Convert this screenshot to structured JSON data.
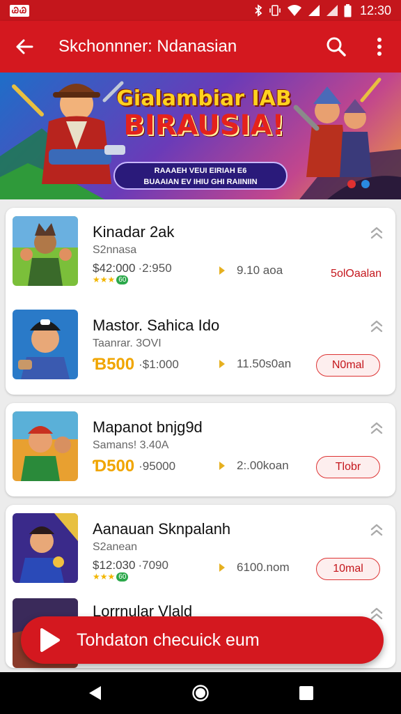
{
  "status_bar": {
    "badge": "ᏊᏊ",
    "time": "12:30"
  },
  "app_bar": {
    "title": "Skchonnner: Ndanasian"
  },
  "banner": {
    "line1": "Gialambiar IAB",
    "line2": "BIRAUSIA!",
    "pill_line1": "RAAAEH VEUI EIRIAH    E6",
    "pill_line2": "BUAAIAN EV IHIU GHI RAIINIIN"
  },
  "items": [
    {
      "title": "Kinadar 2ak",
      "subtitle": "S2nnasa",
      "price_small": "$42:000",
      "price_big": "",
      "price_after": "·2:950",
      "rating_badge": "60",
      "meta": "9.10 aoa",
      "tag": "5olOaalan",
      "tag_style": "text"
    },
    {
      "title": "Mastor. Sahica Ido",
      "subtitle": "Taanrar. 3OVI",
      "price_small": "",
      "price_big": "Ɓ500",
      "price_after": "·$1:000",
      "rating_badge": "",
      "meta": "11.50s0an",
      "tag": "N0mal",
      "tag_style": "pill"
    },
    {
      "title": "Mapanot bnjg9d",
      "subtitle": "Samans! 3.40A",
      "price_small": "",
      "price_big": "Ɗ500",
      "price_after": "·95000",
      "rating_badge": "",
      "meta": "2:.00koan",
      "tag": "Tlobr",
      "tag_style": "pill"
    },
    {
      "title": "Aanauan Sknpalanh",
      "subtitle": "S2anean",
      "price_small": "$12:030",
      "price_big": "",
      "price_after": "·7090",
      "rating_badge": "60",
      "meta": "6100.nom",
      "tag": "10mal",
      "tag_style": "pill"
    }
  ],
  "partial_item": {
    "title": "Lorrnular Vlald"
  },
  "fab": {
    "label": "Tohdaton checuick eum"
  },
  "colors": {
    "primary": "#d4181f",
    "accent": "#f0a500"
  }
}
